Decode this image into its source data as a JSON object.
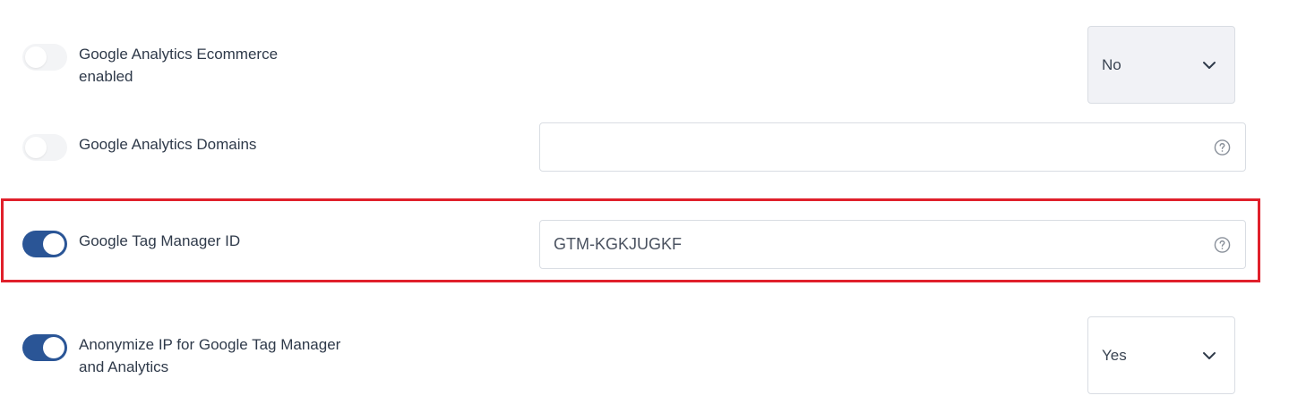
{
  "settings": [
    {
      "label_line1": "Google Analytics Ecommerce",
      "label_line2": "enabled",
      "toggle": "off",
      "select_value": "No"
    },
    {
      "label_line1": "Google Analytics Domains",
      "toggle": "off",
      "input_value": ""
    },
    {
      "label_line1": "Google Tag Manager ID",
      "toggle": "on",
      "input_value": "GTM-KGKJUGKF"
    },
    {
      "label_line1": "Anonymize IP for Google Tag Manager",
      "label_line2": "and Analytics",
      "toggle": "on",
      "select_value": "Yes"
    }
  ],
  "icons": {
    "help": "question-circle-icon",
    "dropdown": "chevron-down-icon"
  },
  "colors": {
    "toggle_on": "#2a5596",
    "toggle_off": "#f3f4f6",
    "highlight": "#e0202b",
    "select_filled_bg": "#f1f2f6",
    "border": "#d9dde3"
  }
}
